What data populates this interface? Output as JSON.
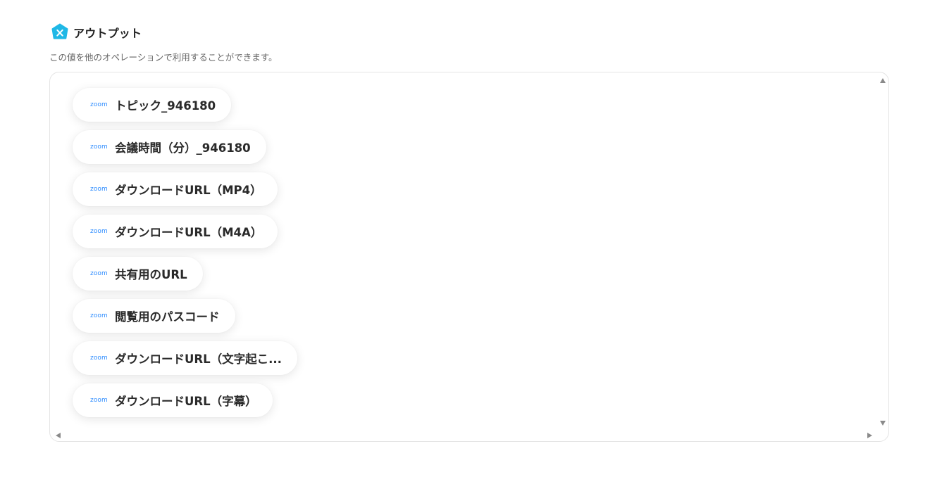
{
  "header": {
    "title": "アウトプット",
    "icon": "x-hexagon-icon",
    "accent": "#1fb8e6"
  },
  "description": "この値を他のオペレーションで利用することができます。",
  "outputs": [
    {
      "source": "zoom",
      "label": "トピック_946180"
    },
    {
      "source": "zoom",
      "label": "会議時間（分）_946180"
    },
    {
      "source": "zoom",
      "label": "ダウンロードURL（MP4）"
    },
    {
      "source": "zoom",
      "label": "ダウンロードURL（M4A）"
    },
    {
      "source": "zoom",
      "label": "共有用のURL"
    },
    {
      "source": "zoom",
      "label": "閲覧用のパスコード"
    },
    {
      "source": "zoom",
      "label": "ダウンロードURL（文字起こ..."
    },
    {
      "source": "zoom",
      "label": "ダウンロードURL（字幕）"
    }
  ],
  "colors": {
    "zoom_brand": "#2d8cff",
    "border": "#e4e4e4"
  }
}
